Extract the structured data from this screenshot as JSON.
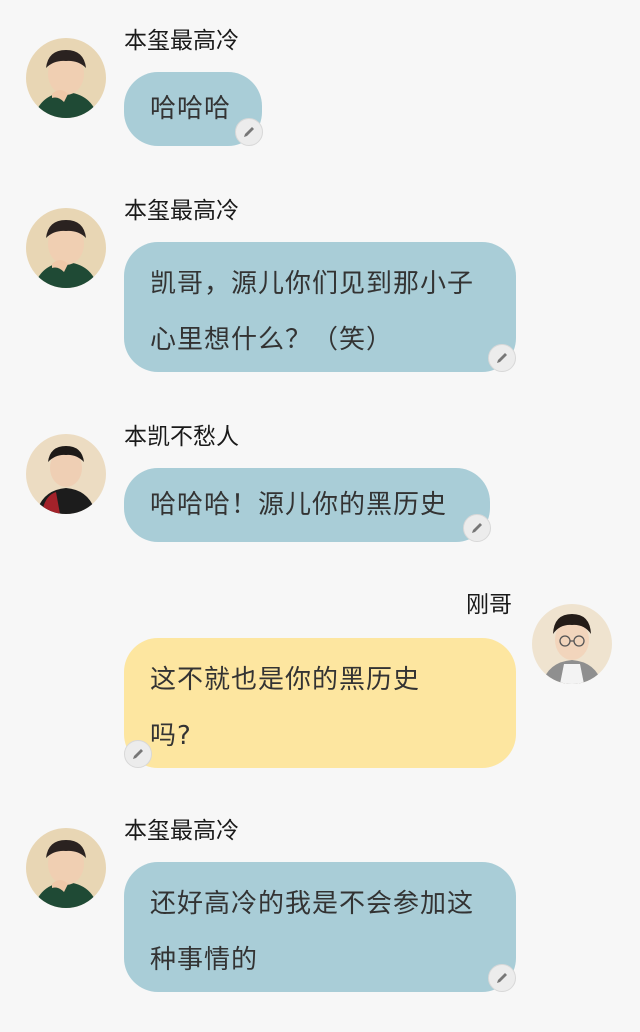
{
  "messages": [
    {
      "sender": "本玺最高冷",
      "text": "哈哈哈",
      "side": "left",
      "avatar": "avatar-qianxi-icon"
    },
    {
      "sender": "本玺最高冷",
      "text": "凯哥，源儿你们见到那小子心里想什么？（笑）",
      "side": "left",
      "avatar": "avatar-qianxi-icon"
    },
    {
      "sender": "本凯不愁人",
      "text": "哈哈哈！源儿你的黑历史",
      "side": "left",
      "avatar": "avatar-kai-icon"
    },
    {
      "sender": "刚哥",
      "text": "这不就也是你的黑历史吗?",
      "side": "right",
      "avatar": "avatar-gang-icon"
    },
    {
      "sender": "本玺最高冷",
      "text": "还好高冷的我是不会参加这种事情的",
      "side": "left",
      "avatar": "avatar-qianxi-icon"
    }
  ],
  "colors": {
    "bubble_blue": "#a9cdd7",
    "bubble_yellow": "#fde6a0",
    "background": "#f7f7f7"
  },
  "icons": {
    "edit": "pencil-icon"
  }
}
